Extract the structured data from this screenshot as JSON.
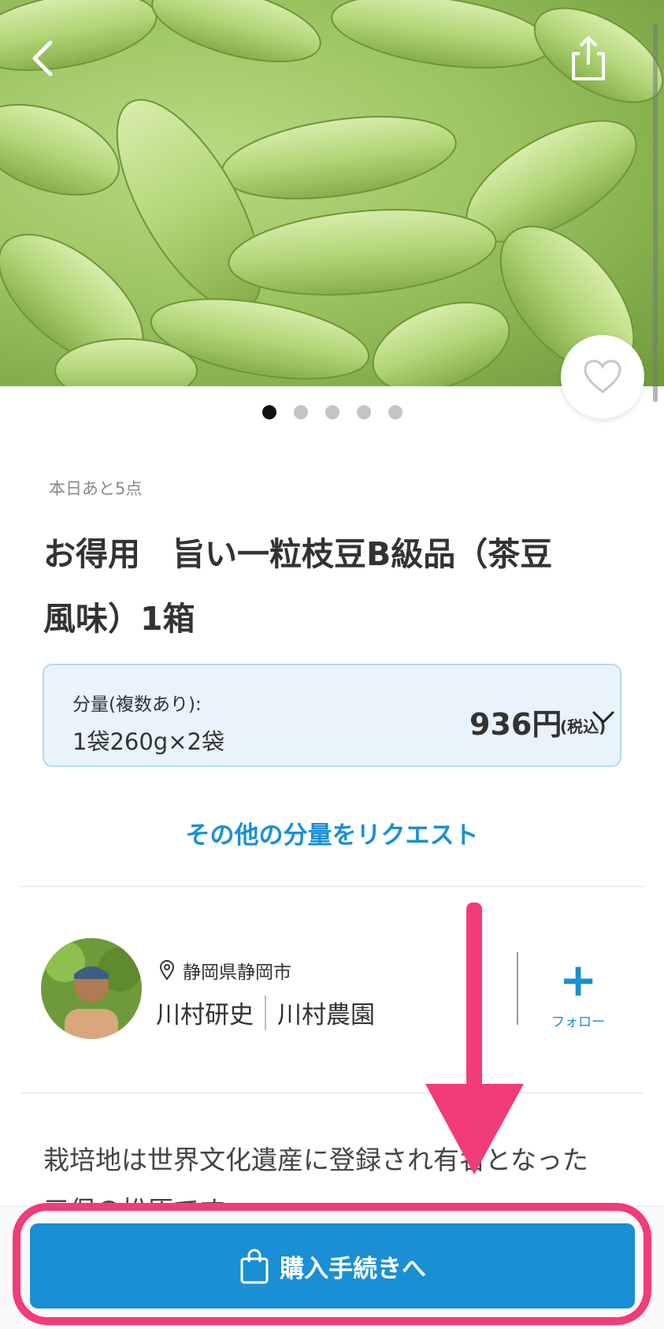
{
  "colors": {
    "accent": "#1a8fd4",
    "highlight": "#f23b7a",
    "variant_bg": "#e8f3fb"
  },
  "hero": {
    "alt": "edamame-photo",
    "slide_count": 5,
    "active_slide": 1
  },
  "header": {
    "back_icon": "chevron-left-icon",
    "share_icon": "share-icon"
  },
  "favorite": {
    "icon": "heart-outline-icon"
  },
  "product": {
    "stock_note": "本日あと5点",
    "title_line1": "お得用　旨い一粒枝豆B級品（茶豆",
    "title_line2": "風味）1箱"
  },
  "variant": {
    "label": "分量(複数あり):",
    "value": "1袋260g×2袋",
    "price": "936円",
    "tax_note": "(税込)"
  },
  "request_link": "その他の分量をリクエスト",
  "producer": {
    "location": "静岡県静岡市",
    "name": "川村研史",
    "farm": "川村農園",
    "follow_label": "フォロー"
  },
  "description": {
    "line1": "栽培地は世界文化遺産に登録され有名となった",
    "line2": "三保の松原です。"
  },
  "purchase": {
    "label": "購入手続きへ",
    "icon": "shopping-bag-icon"
  }
}
